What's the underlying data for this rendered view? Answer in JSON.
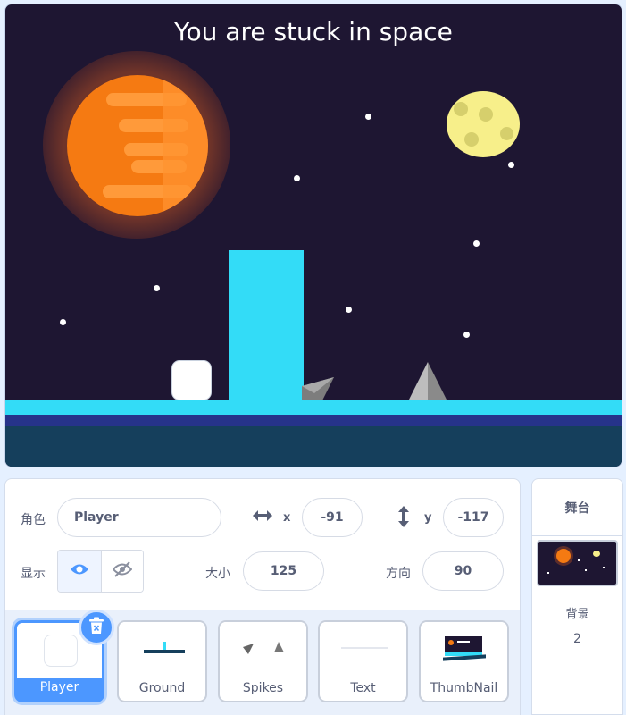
{
  "stage": {
    "title": "You are stuck in space"
  },
  "sprite_info": {
    "sprite_label": "角色",
    "sprite_name": "Player",
    "x_label": "x",
    "x_value": "-91",
    "y_label": "y",
    "y_value": "-117",
    "show_label": "显示",
    "size_label": "大小",
    "size_value": "125",
    "direction_label": "方向",
    "direction_value": "90"
  },
  "sprites": [
    {
      "name": "Player",
      "selected": true
    },
    {
      "name": "Ground",
      "selected": false
    },
    {
      "name": "Spikes",
      "selected": false
    },
    {
      "name": "Text",
      "selected": false
    },
    {
      "name": "ThumbNail",
      "selected": false
    }
  ],
  "stage_pane": {
    "title": "舞台",
    "backdrop_label": "背景",
    "backdrop_count": "2"
  },
  "colors": {
    "accent": "#4c97ff",
    "sky": "#1e1632",
    "cyan": "#33dcf7",
    "planet": "#f57a12",
    "moon": "#f7ef8a"
  },
  "icons": [
    "x-arrows-icon",
    "y-arrows-icon",
    "eye-icon",
    "eye-hidden-icon",
    "trash-icon"
  ]
}
